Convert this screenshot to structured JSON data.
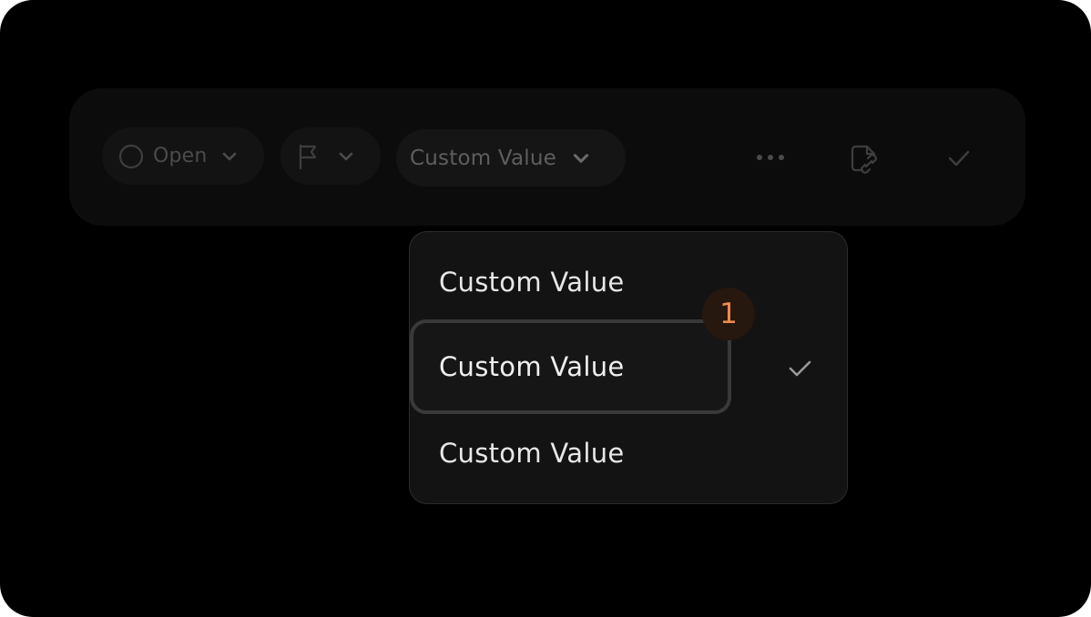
{
  "toolbar": {
    "status": {
      "label": "Open",
      "icon": "circle-icon"
    },
    "flag": {
      "icon": "flag-icon"
    },
    "custom_field": {
      "label": "Custom Value",
      "icon": "chevron-down-icon"
    },
    "actions": [
      {
        "icon": "more-horizontal-icon"
      },
      {
        "icon": "file-link-icon"
      },
      {
        "icon": "check-icon"
      }
    ]
  },
  "dropdown": {
    "options": [
      {
        "label": "Custom Value",
        "selected": false
      },
      {
        "label": "Custom Value",
        "selected": true
      },
      {
        "label": "Custom Value",
        "selected": false
      }
    ],
    "badge": "1"
  },
  "colors": {
    "background": "#000000",
    "toolbar": "#0c0c0d",
    "dropdown": "#131314",
    "badge_text": "#ee8a4e",
    "badge_bg": "#26170f"
  }
}
